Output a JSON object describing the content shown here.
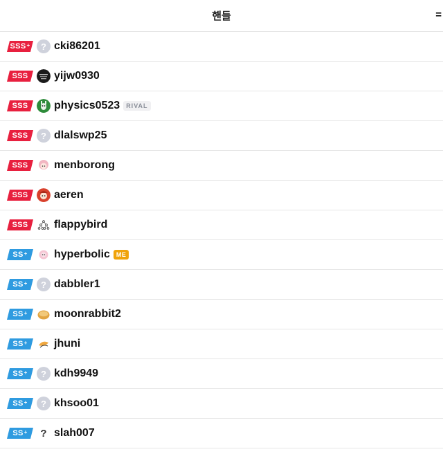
{
  "header": {
    "title": "핸들",
    "menu_glyph": "="
  },
  "rows": [
    {
      "tier": "SSS",
      "plus": "+",
      "cls": "sss",
      "avatar": "unknown-avatar",
      "handle": "cki86201",
      "badge": ""
    },
    {
      "tier": "SSS",
      "plus": "",
      "cls": "sss",
      "avatar": "dark-avatar",
      "handle": "yijw0930",
      "badge": ""
    },
    {
      "tier": "SSS",
      "plus": "",
      "cls": "sss",
      "avatar": "green-avatar",
      "handle": "physics0523",
      "badge": "RIVAL"
    },
    {
      "tier": "SSS",
      "plus": "",
      "cls": "sss",
      "avatar": "unknown-avatar",
      "handle": "dlalswp25",
      "badge": ""
    },
    {
      "tier": "SSS",
      "plus": "",
      "cls": "sss",
      "avatar": "pink-character-avatar",
      "handle": "menborong",
      "badge": ""
    },
    {
      "tier": "SSS",
      "plus": "",
      "cls": "sss",
      "avatar": "red-character-avatar",
      "handle": "aeren",
      "badge": ""
    },
    {
      "tier": "SSS",
      "plus": "",
      "cls": "sss",
      "avatar": "tree-avatar",
      "handle": "flappybird",
      "badge": ""
    },
    {
      "tier": "SS",
      "plus": "+",
      "cls": "ss",
      "avatar": "pink-flower-avatar",
      "handle": "hyperbolic",
      "badge": "ME"
    },
    {
      "tier": "SS",
      "plus": "+",
      "cls": "ss",
      "avatar": "unknown-avatar",
      "handle": "dabbler1",
      "badge": ""
    },
    {
      "tier": "SS",
      "plus": "+",
      "cls": "ss",
      "avatar": "bread-avatar",
      "handle": "moonrabbit2",
      "badge": ""
    },
    {
      "tier": "SS",
      "plus": "+",
      "cls": "ss",
      "avatar": "orange-sketch-avatar",
      "handle": "jhuni",
      "badge": ""
    },
    {
      "tier": "SS",
      "plus": "+",
      "cls": "ss",
      "avatar": "unknown-avatar",
      "handle": "kdh9949",
      "badge": ""
    },
    {
      "tier": "SS",
      "plus": "+",
      "cls": "ss",
      "avatar": "unknown-avatar",
      "handle": "khsoo01",
      "badge": ""
    },
    {
      "tier": "SS",
      "plus": "+",
      "cls": "ss",
      "avatar": "question-mark-avatar",
      "handle": "slah007",
      "badge": ""
    }
  ],
  "colors": {
    "sss": "#e8203f",
    "ss": "#2f9be0",
    "me_badge": "#f0a30a",
    "rival_badge_bg": "#f0f0f2"
  }
}
